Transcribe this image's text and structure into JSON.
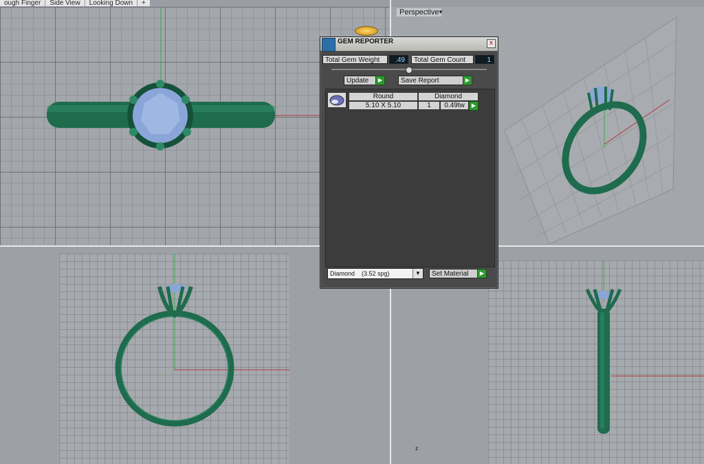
{
  "tabs": [
    "ough Finger",
    "Side View",
    "Looking Down",
    "+"
  ],
  "viewports": {
    "top_right_label": "Perspective",
    "bottom_right_axis": "z"
  },
  "gem_reporter": {
    "title": "GEM REPORTER",
    "close": "x",
    "total_weight_label": "Total Gem Weight",
    "total_weight_value": ".49",
    "total_count_label": "Total Gem Count",
    "total_count_value": "1",
    "update_button": "Update",
    "save_button": "Save Report",
    "table": {
      "headers": [
        "Round",
        "Diamond"
      ],
      "row": {
        "size": "5.10 X 5.10",
        "count": "1",
        "weight": "0.49tw"
      }
    },
    "material_select": "Diamond    (3.52 spg)",
    "set_material_button": "Set Material"
  },
  "colors": {
    "ring_green": "#1f6b4e",
    "gem_blue": "#8aa6d8",
    "panel_bg": "#4a4a4a",
    "button_green": "#2f9a2f"
  }
}
